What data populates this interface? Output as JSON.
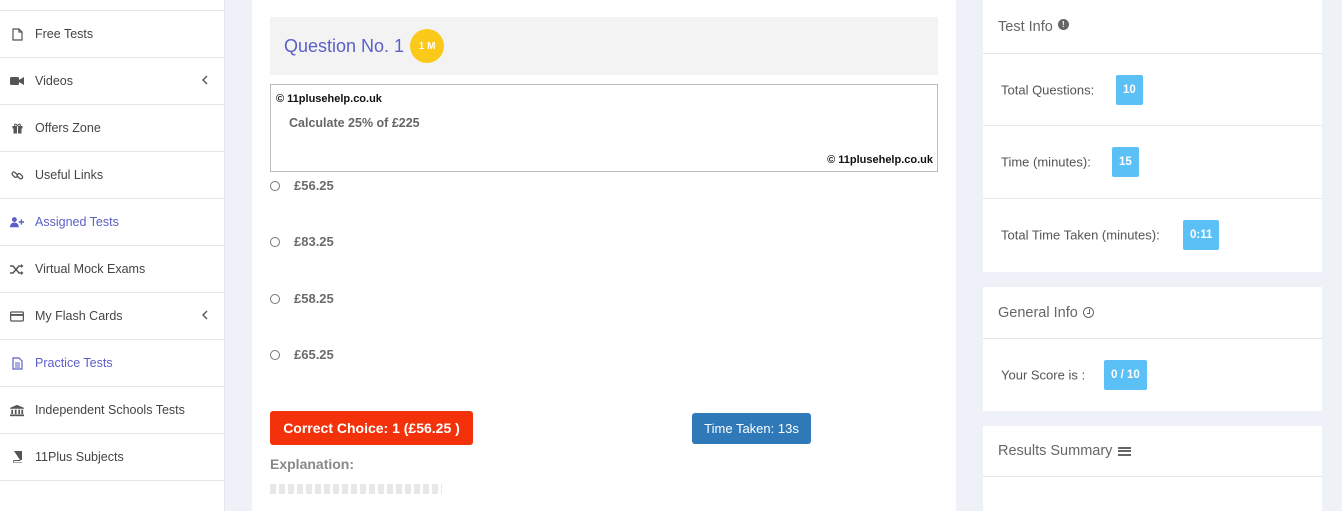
{
  "sidebar": {
    "items": [
      {
        "label": "Free Tests",
        "icon": "file-icon"
      },
      {
        "label": "Videos",
        "icon": "video-camera-icon"
      },
      {
        "label": "Offers Zone",
        "icon": "gift-icon"
      },
      {
        "label": "Useful Links",
        "icon": "link-icon"
      },
      {
        "label": "Assigned Tests",
        "icon": "user-plus-icon"
      },
      {
        "label": "Virtual Mock Exams",
        "icon": "shuffle-icon"
      },
      {
        "label": "My Flash Cards",
        "icon": "credit-card-icon"
      },
      {
        "label": "Practice Tests",
        "icon": "document-icon"
      },
      {
        "label": "Independent Schools Tests",
        "icon": "bank-icon"
      },
      {
        "label": "11Plus Subjects",
        "icon": "book-icon"
      }
    ]
  },
  "question": {
    "title": "Question No. 1",
    "marks": "1 M",
    "watermark": "© 11plusehelp.co.uk",
    "text": "Calculate 25% of £225",
    "options": [
      "£56.25",
      "£83.25",
      "£58.25",
      "£65.25"
    ]
  },
  "result": {
    "correct_choice": "Correct Choice: 1 (£56.25 )",
    "time_taken": "Time Taken: 13s",
    "explanation_label": "Explanation:"
  },
  "test_info": {
    "title": "Test Info",
    "rows": [
      {
        "label": "Total Questions:",
        "value": "10"
      },
      {
        "label": "Time (minutes):",
        "value": "15"
      },
      {
        "label": "Total Time Taken (minutes):",
        "value": "0:11"
      }
    ]
  },
  "general_info": {
    "title": "General Info",
    "score_label": "Your Score is :",
    "score_value": "0 / 10"
  },
  "results_summary": {
    "title": "Results Summary"
  },
  "colors": {
    "accent": "#5b5fc7",
    "correct": "#f3320b",
    "time": "#2f79b9",
    "badge": "#5bc0f5",
    "marks": "#fbc91a"
  }
}
